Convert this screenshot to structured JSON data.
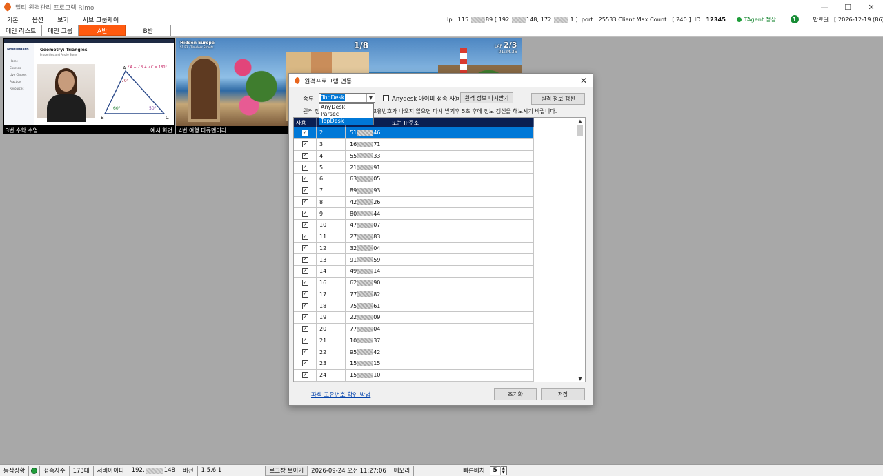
{
  "window": {
    "title": "멀티 원격관리 프로그램 Rimo",
    "minimize": "—",
    "maximize": "☐",
    "close": "✕"
  },
  "menu": {
    "items": [
      "기본",
      "옵션",
      "보기",
      "서브 그룹제어"
    ]
  },
  "status_line": {
    "ip_prefix": "Ip : 115.",
    "ip_mid1": "89 [ 192.",
    "ip_mid2": "148, 172.",
    "ip_end": ".1 ]",
    "port": "port : 25533",
    "client_max": "Client Max Count : [ 240 ]",
    "id_label": "ID :",
    "id_value": "12345",
    "agent": "TAgent 정상",
    "badge": "1",
    "expiry": "만료일 : [ 2026-12-19 (86) ]"
  },
  "tabs": {
    "main_list": "메인 리스트",
    "main_group": "메인 그룹",
    "a_group": "A반",
    "b_group": "B반"
  },
  "thumbnails": [
    {
      "caption_left": "3번 수학 수업",
      "caption_right": "예시 화면",
      "brand": "NowieMath",
      "lesson_title": "Geometry: Triangles",
      "lesson_sub": "Properties and Angle Sums",
      "side_items": [
        "Home",
        "Courses",
        "Live Classes",
        "Practice",
        "Resources"
      ],
      "formula": "∠A + ∠B + ∠C = 180°",
      "angle_a": "70°",
      "angle_b": "60°",
      "angle_c": "50°",
      "vertex_a": "A",
      "vertex_b": "B",
      "vertex_c": "C"
    },
    {
      "caption_left": "4번 여행 다큐멘터리",
      "caption_right": "",
      "title": "Hidden Europe",
      "subtitle": "S1 E3 · Timeless Streets",
      "counter": "1/8",
      "lap_label": "LAP",
      "lap_value": "2/3",
      "lap_time": "01:24.36"
    }
  ],
  "dialog": {
    "title": "원격프로그램 연동",
    "type_label": "종류",
    "selected_type": "TopDesk",
    "options": [
      "AnyDesk",
      "Parsec",
      "TopDesk"
    ],
    "anydesk_check_label": "Anydesk 아이피 접속 사용",
    "reload_button": "원격 정보 다시받기",
    "refresh_button": "원격 정보 갱신",
    "hint_prefix": "원격 정",
    "hint": "고유번호가 나오지 않으면 다시 받기후 5초 후에 정보 갱신을 해보시기 바랍니다.",
    "columns": {
      "use": "사용",
      "no": "",
      "ip": "또는 IP주소"
    },
    "rows": [
      {
        "no": "2",
        "ip_a": "51",
        "ip_b": "46",
        "checked": true,
        "selected": true
      },
      {
        "no": "3",
        "ip_a": "16",
        "ip_b": "71",
        "checked": true
      },
      {
        "no": "4",
        "ip_a": "55",
        "ip_b": "33",
        "checked": true
      },
      {
        "no": "5",
        "ip_a": "21",
        "ip_b": "91",
        "checked": true
      },
      {
        "no": "6",
        "ip_a": "63",
        "ip_b": "05",
        "checked": true
      },
      {
        "no": "7",
        "ip_a": "89",
        "ip_b": "93",
        "checked": true
      },
      {
        "no": "8",
        "ip_a": "42",
        "ip_b": "26",
        "checked": true
      },
      {
        "no": "9",
        "ip_a": "80",
        "ip_b": "44",
        "checked": true
      },
      {
        "no": "10",
        "ip_a": "47",
        "ip_b": "07",
        "checked": true
      },
      {
        "no": "11",
        "ip_a": "27",
        "ip_b": "83",
        "checked": true
      },
      {
        "no": "12",
        "ip_a": "32",
        "ip_b": "04",
        "checked": true
      },
      {
        "no": "13",
        "ip_a": "91",
        "ip_b": "59",
        "checked": true
      },
      {
        "no": "14",
        "ip_a": "49",
        "ip_b": "14",
        "checked": true
      },
      {
        "no": "16",
        "ip_a": "62",
        "ip_b": "90",
        "checked": true
      },
      {
        "no": "17",
        "ip_a": "77",
        "ip_b": "82",
        "checked": true
      },
      {
        "no": "18",
        "ip_a": "75",
        "ip_b": "61",
        "checked": true
      },
      {
        "no": "19",
        "ip_a": "22",
        "ip_b": "09",
        "checked": true
      },
      {
        "no": "20",
        "ip_a": "77",
        "ip_b": "04",
        "checked": true
      },
      {
        "no": "21",
        "ip_a": "10",
        "ip_b": "37",
        "checked": true
      },
      {
        "no": "22",
        "ip_a": "95",
        "ip_b": "42",
        "checked": true
      },
      {
        "no": "23",
        "ip_a": "15",
        "ip_b": "15",
        "checked": true
      },
      {
        "no": "24",
        "ip_a": "15",
        "ip_b": "10",
        "checked": true
      }
    ],
    "help_link": "파섹 고유번호 확인 방법",
    "reset_button": "초기화",
    "save_button": "저장"
  },
  "statusbar": {
    "state_label": "동작상황",
    "conn_label": "접속자수",
    "conn_value": "173대",
    "server_ip_label": "서버아이피",
    "server_ip_prefix": "192.",
    "server_ip_suffix": "148",
    "version_label": "버전",
    "version_value": "1.5.6.1",
    "log_button": "로그창 보이기",
    "datetime": "2026-09-24 오전 11:27:06",
    "memory_label": "메모리",
    "quick_label": "빠른배치",
    "quick_value": "5"
  },
  "colors": {
    "accent": "#ff5a0f",
    "selection": "#0078d7",
    "header": "#0a1f52",
    "ok": "#1f9d3a"
  }
}
